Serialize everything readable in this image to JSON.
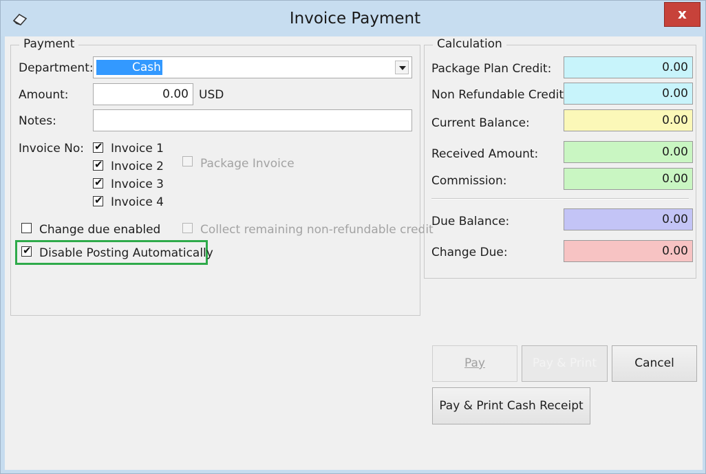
{
  "window": {
    "title": "Invoice Payment",
    "close_label": "x"
  },
  "payment": {
    "group_title": "Payment",
    "department_label": "Department:",
    "department_value": "Cash",
    "amount_label": "Amount:",
    "amount_value": "0.00",
    "currency": "USD",
    "notes_label": "Notes:",
    "notes_value": "",
    "invoice_no_label": "Invoice No:",
    "invoices": [
      {
        "label": "Invoice 1",
        "checked": true
      },
      {
        "label": "Invoice 2",
        "checked": true
      },
      {
        "label": "Invoice 3",
        "checked": true
      },
      {
        "label": "Invoice 4",
        "checked": true
      }
    ],
    "package_invoice_label": "Package Invoice",
    "change_due_label": "Change due enabled",
    "collect_label": "Collect remaining non-refundable credit",
    "disable_posting_label": "Disable Posting Automatically"
  },
  "calculation": {
    "group_title": "Calculation",
    "rows": [
      {
        "label": "Package Plan Credit:",
        "value": "0.00",
        "color": "#c8f4fb"
      },
      {
        "label": "Non Refundable Credit:",
        "value": "0.00",
        "color": "#c8f4fb"
      },
      {
        "label": "Current Balance:",
        "value": "0.00",
        "color": "#fbf8b8"
      },
      {
        "label": "Received Amount:",
        "value": "0.00",
        "color": "#c9f6c2"
      },
      {
        "label": "Commission:",
        "value": "0.00",
        "color": "#c9f6c2"
      },
      {
        "label": "Due Balance:",
        "value": "0.00",
        "color": "#c3c4f6"
      },
      {
        "label": "Change Due:",
        "value": "0.00",
        "color": "#f7c3c3"
      }
    ]
  },
  "buttons": {
    "pay": "Pay",
    "pay_print": "Pay & Print",
    "cancel": "Cancel",
    "pay_print_cash_receipt": "Pay & Print Cash Receipt"
  },
  "colors": {
    "highlight_box": "#2eaa4a",
    "selection": "#3399ff"
  }
}
